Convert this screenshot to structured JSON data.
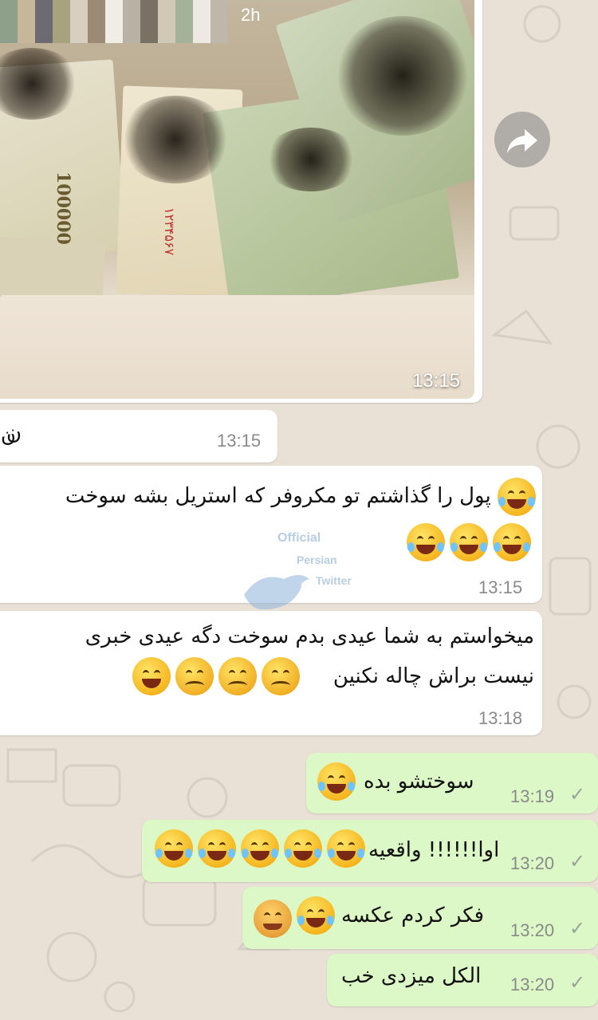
{
  "story": {
    "age": "2h"
  },
  "photo_message": {
    "time": "13:15"
  },
  "messages": [
    {
      "text": "ن",
      "time": "13:15"
    },
    {
      "line1": "پول را گذاشتم تو مکروفر که استریل بشه سوخت",
      "time": "13:15"
    },
    {
      "line1": "میخواستم به شما عیدی بدم سوخت دگه عیدی خبری",
      "line2": "نیست براش چاله نکنین",
      "time": "13:18"
    },
    {
      "text": "سوختشو بده",
      "time": "13:19"
    },
    {
      "text": "اوا!!!!!! واقعیه",
      "time": "13:20"
    },
    {
      "text": "فکر کردم عکسه",
      "time": "13:20"
    },
    {
      "text": "الکل میزدی خب",
      "time": "13:20"
    }
  ],
  "banknote": {
    "denomination": "100000",
    "serial": "۱۲۳۴۵۶۷"
  },
  "watermark": {
    "line1": "Official",
    "line2": "Persian",
    "line3": "Twitter"
  },
  "icons": {
    "forward": "forward-share-icon",
    "check": "single-check-icon"
  },
  "colors": {
    "incoming": "#ffffff",
    "outgoing": "#dcf8c6",
    "wallpaper": "#e9e1d6"
  }
}
